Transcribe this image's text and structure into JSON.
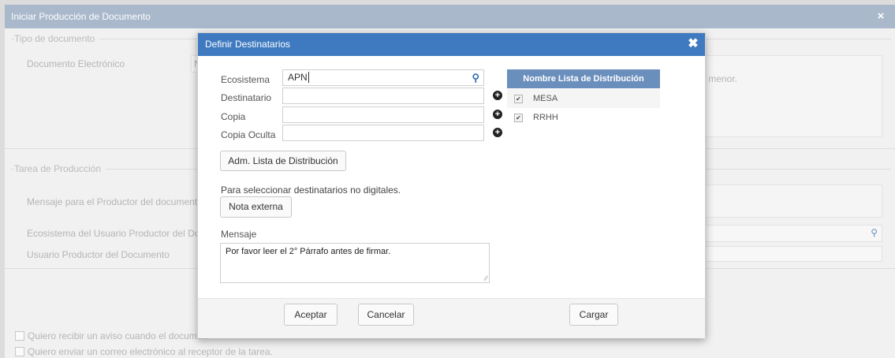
{
  "background": {
    "title": "Iniciar Producción de Documento",
    "close_icon": "×",
    "tipo_legend": "Tipo de documento",
    "documento_label": "Documento Electrónico",
    "documento_value_fragment": "N",
    "hint_fragment": "r menor.",
    "tarea_legend": "Tarea de Producción",
    "mensaje_productor_label": "Mensaje para el Productor del documento",
    "ecosistema_productor_label": "Ecosistema del Usuario Productor del Doc",
    "usuario_productor_label": "Usuario Productor del Documento",
    "aviso_check_label": "Quiero recibir un aviso cuando el documen",
    "correo_check_label": "Quiero enviar un correo electrónico al receptor de la tarea."
  },
  "modal": {
    "title": "Definir Destinatarios",
    "close_icon": "✖",
    "fields": {
      "ecosistema_label": "Ecosistema",
      "ecosistema_value": "APN",
      "destinatario_label": "Destinatario",
      "destinatario_value": "",
      "copia_label": "Copia",
      "copia_value": "",
      "copia_oculta_label": "Copia Oculta",
      "copia_oculta_value": ""
    },
    "adm_button": "Adm. Lista de Distribución",
    "no_digital_text": "Para seleccionar destinatarios no digitales.",
    "nota_button": "Nota externa",
    "mensaje_label": "Mensaje",
    "mensaje_value": "Por favor leer el 2° Párrafo antes de firmar.",
    "lista": {
      "header": "Nombre Lista de Distribución",
      "items": [
        {
          "label": "MESA",
          "checked": true
        },
        {
          "label": "RRHH",
          "checked": true
        }
      ]
    },
    "footer": {
      "aceptar": "Aceptar",
      "cancelar": "Cancelar",
      "cargar": "Cargar"
    }
  },
  "colors": {
    "modal_header": "#3f7ac0",
    "list_header": "#6b8fbd",
    "bg_header": "#a9b8cb"
  }
}
